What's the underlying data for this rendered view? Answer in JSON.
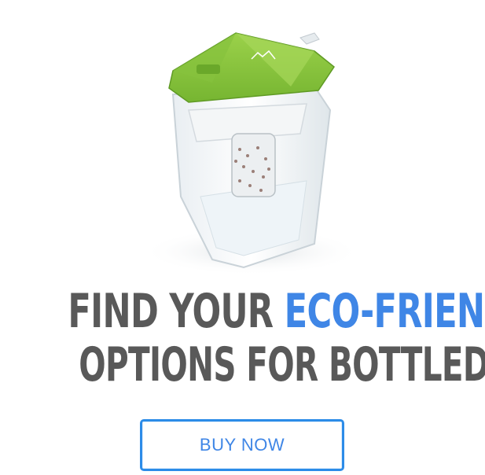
{
  "headline": {
    "line1_prefix": "FIND YOUR ",
    "line1_accent": "ECO-FRIENDLY",
    "line2": "OPTIONS FOR BOTTLED WATER"
  },
  "cta": {
    "label": "BUY NOW"
  },
  "colors": {
    "text_gray": "#595959",
    "accent_blue": "#3f86e6",
    "button_border": "#2c8ce8",
    "lid_green": "#8cc63f",
    "background": "#ffffff"
  },
  "product_image": {
    "icon": "water-pitcher-icon"
  }
}
